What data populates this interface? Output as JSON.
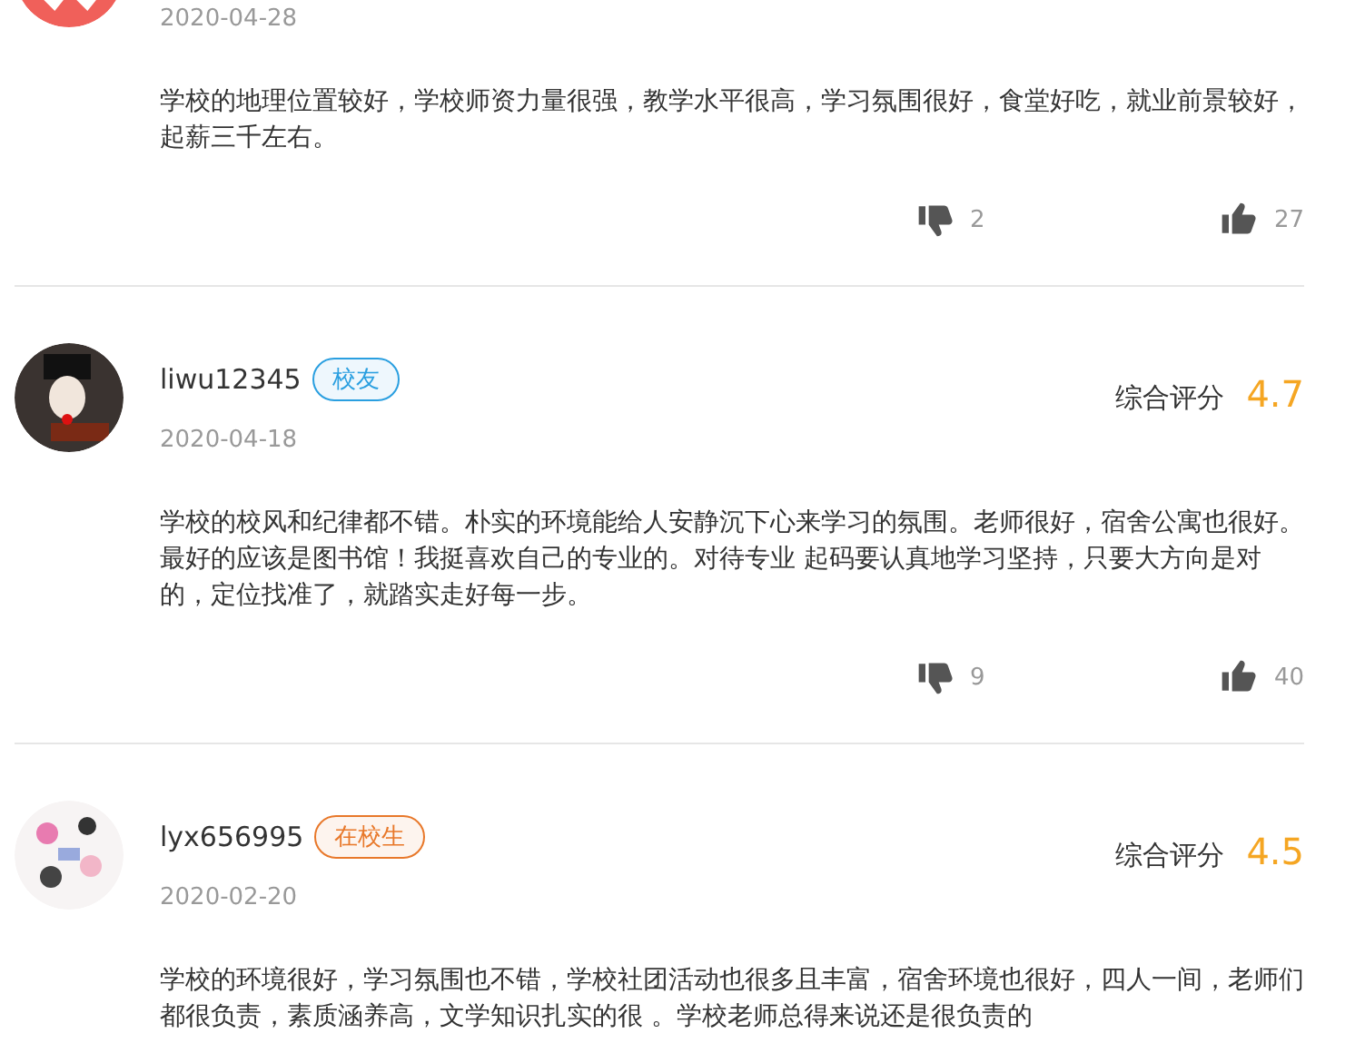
{
  "reviews": [
    {
      "date": "2020-04-28",
      "text": "学校的地理位置较好，学校师资力量很强，教学水平很高，学习氛围很好，食堂好吃，就业前景较好，起薪三千左右。",
      "dislikes": "2",
      "likes": "27"
    },
    {
      "user": "liwu12345",
      "badge": {
        "label": "校友",
        "color": "#2a9fe0"
      },
      "date": "2020-04-18",
      "rating_label": "综合评分",
      "rating": "4.7",
      "text": "学校的校风和纪律都不错。朴实的环境能给人安静沉下心来学习的氛围。老师很好，宿舍公寓也很好。最好的应该是图书馆！我挺喜欢自己的专业的。对待专业 起码要认真地学习坚持，只要大方向是对的，定位找准了，就踏实走好每一步。",
      "dislikes": "9",
      "likes": "40"
    },
    {
      "user": "lyx656995",
      "badge": {
        "label": "在校生",
        "color": "#e8782a"
      },
      "date": "2020-02-20",
      "rating_label": "综合评分",
      "rating": "4.5",
      "text": "学校的环境很好，学习氛围也不错，学校社团活动也很多且丰富，宿舍环境也很好，四人一间，老师们都很负责，素质涵养高，文学知识扎实的很 。学校老师总得来说还是很负责的"
    }
  ]
}
